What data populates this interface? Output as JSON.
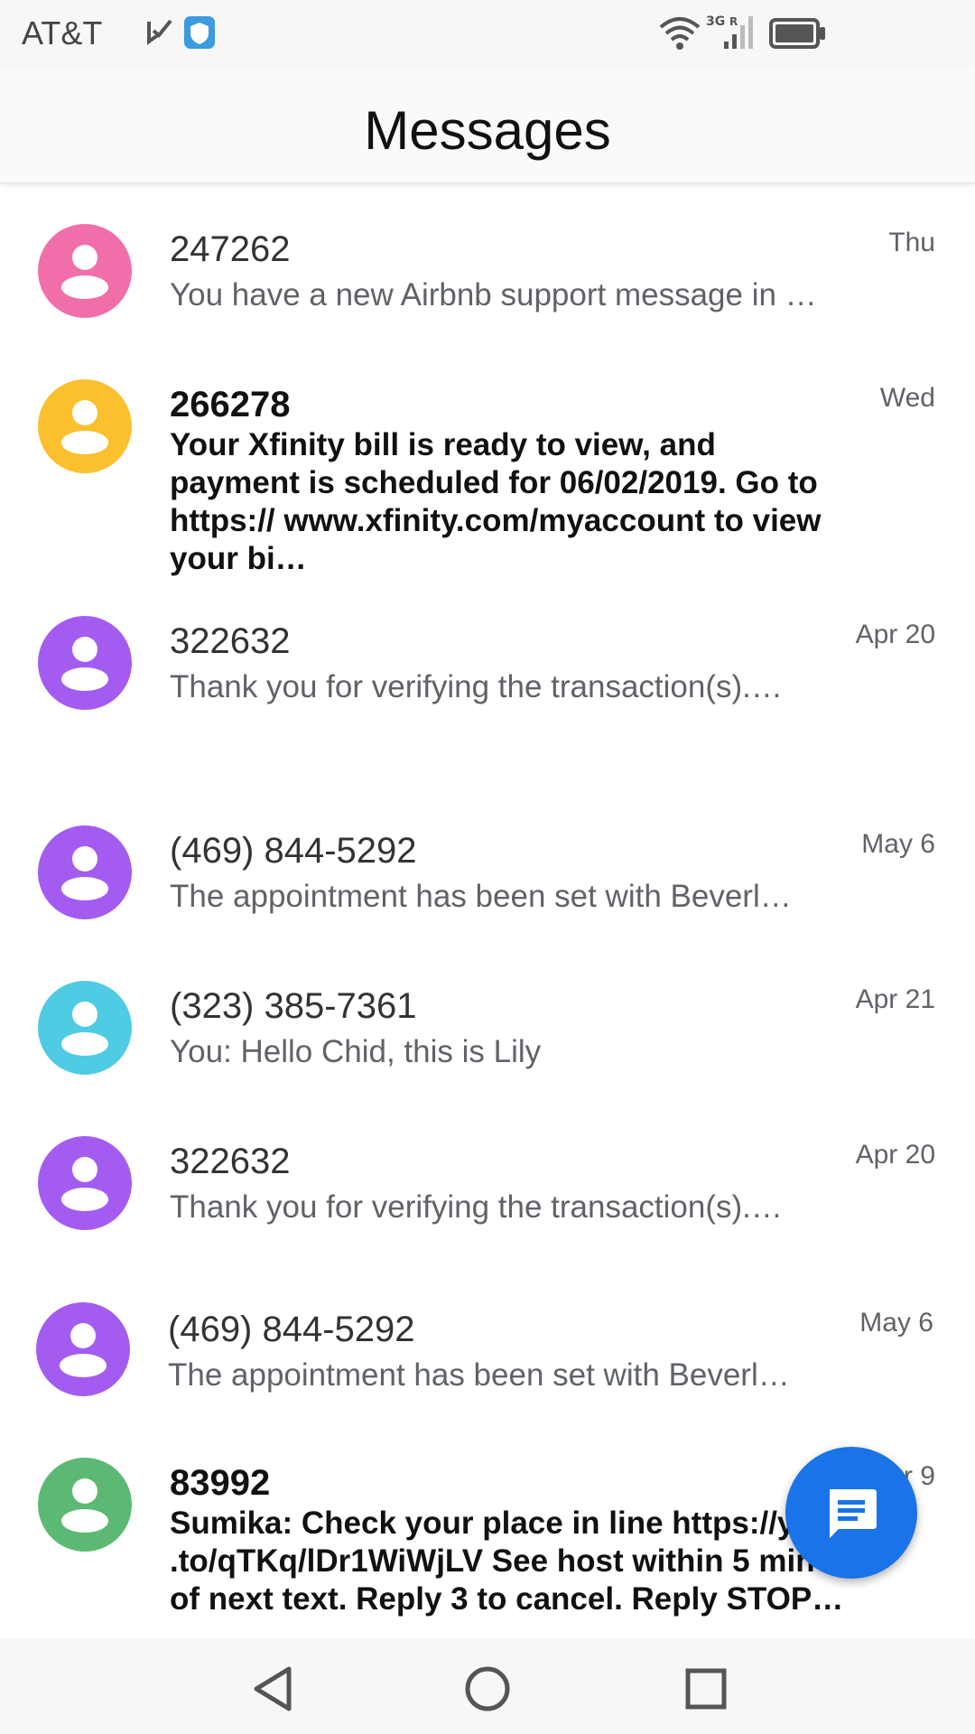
{
  "status_bar": {
    "carrier": "AT&T",
    "network": "3G",
    "roaming": "R"
  },
  "app": {
    "title": "Messages"
  },
  "conversations": [
    {
      "sender": "247262",
      "snippet": "You have a new Airbnb support message in …",
      "time": "Thu",
      "unread": false,
      "avatar_color": "#f06eaa"
    },
    {
      "sender": "266278",
      "snippet": "Your Xfinity bill is ready to view, and payment is scheduled for 06/02/2019. Go to https:// www.xfinity.com/myaccount to view your bi…",
      "time": "Wed",
      "unread": true,
      "avatar_color": "#fbc02d"
    },
    {
      "sender": "322632",
      "snippet": "Thank you for verifying the transaction(s).…",
      "time": "Apr 20",
      "unread": false,
      "avatar_color": "#a45cf0"
    },
    {
      "sender": "(469) 844-5292",
      "snippet": "The appointment has been set with Beverl…",
      "time": "May 6",
      "unread": false,
      "avatar_color": "#a45cf0"
    },
    {
      "sender": "(323) 385-7361",
      "snippet": "You: Hello Chid, this is Lily",
      "time": "Apr 21",
      "unread": false,
      "avatar_color": "#4fcbe3"
    },
    {
      "sender": "322632",
      "snippet": "Thank you for verifying the transaction(s).…",
      "time": "Apr 20",
      "unread": false,
      "avatar_color": "#a45cf0"
    },
    {
      "sender": "(469) 844-5292",
      "snippet": "The appointment has been set with Beverl…",
      "time": "May 6",
      "unread": false,
      "avatar_color": "#a45cf0"
    },
    {
      "sender": "83992",
      "snippet": "Sumika: Check your place in line https://yo .to/qTKq/lDr1WiWjLV See host within 5 min of next text. Reply 3 to cancel. Reply STOP…",
      "time": "r 9",
      "unread": true,
      "avatar_color": "#5bb974"
    }
  ],
  "fab": {
    "icon": "chat-icon"
  },
  "nav": {
    "back": "back-icon",
    "home": "home-icon",
    "recents": "recents-icon"
  }
}
